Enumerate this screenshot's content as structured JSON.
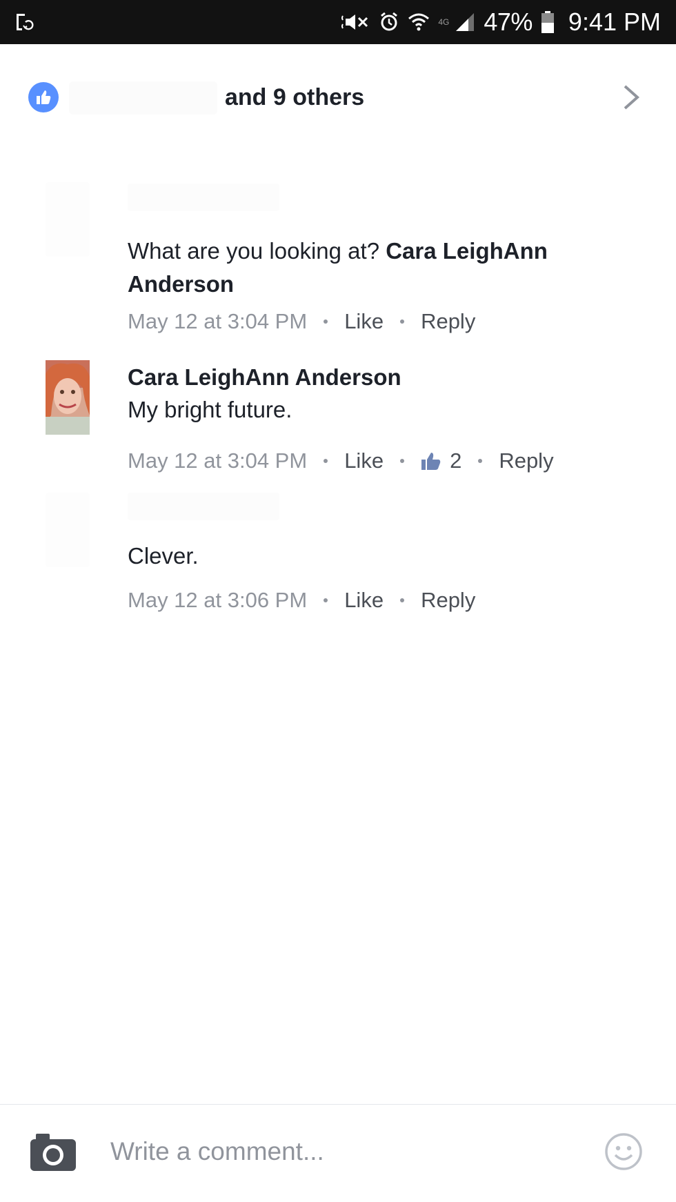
{
  "status_bar": {
    "left_icon": "screenshot-icon",
    "network_label": "4G",
    "battery_percent": "47%",
    "time": "9:41 PM"
  },
  "reactions": {
    "icon": "thumbs-up-icon",
    "summary": "and 9 others",
    "chevron_icon": "chevron-right-icon"
  },
  "comments": [
    {
      "text": "What are you looking at? ",
      "mention": "Cara LeighAnn Anderson",
      "timestamp": "May 12 at 3:04 PM",
      "like_label": "Like",
      "reply_label": "Reply"
    },
    {
      "author": "Cara LeighAnn Anderson",
      "text": "My bright future.",
      "timestamp": "May 12 at 3:04 PM",
      "like_label": "Like",
      "likes_count": "2",
      "reply_label": "Reply"
    },
    {
      "text": "Clever.",
      "timestamp": "May 12 at 3:06 PM",
      "like_label": "Like",
      "reply_label": "Reply"
    }
  ],
  "composer": {
    "placeholder": "Write a comment...",
    "camera_icon": "camera-icon",
    "emoji_icon": "smiley-icon"
  },
  "colors": {
    "status_bar_bg": "#121212",
    "like_blue": "#5890ff",
    "text_primary": "#1d2129",
    "text_secondary": "#90949c",
    "action_text": "#4b4f56"
  }
}
